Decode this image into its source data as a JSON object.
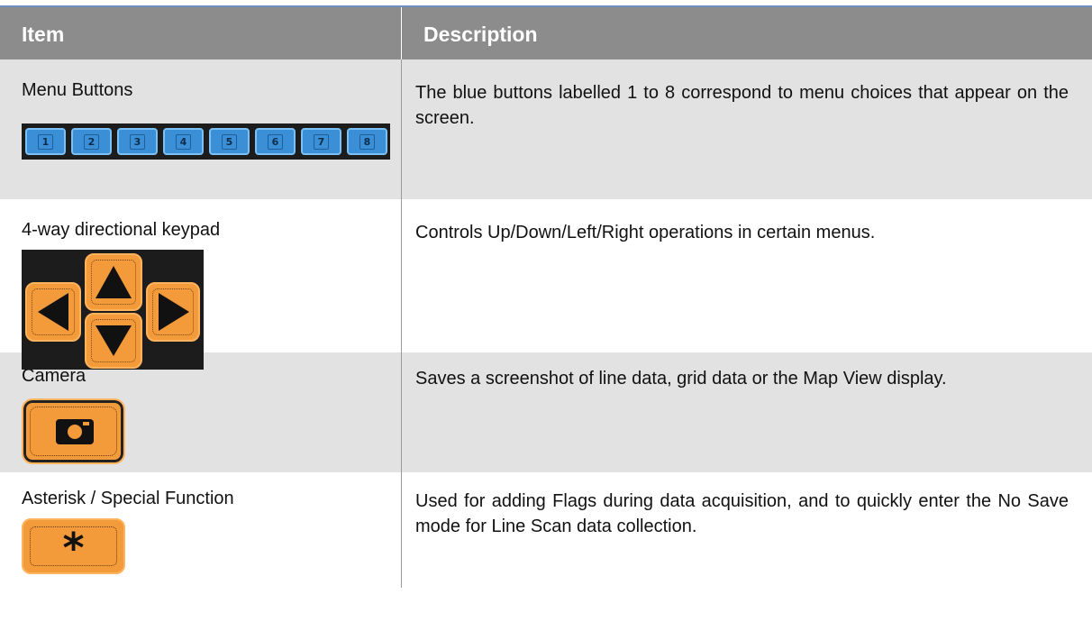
{
  "header": {
    "item": "Item",
    "description": "Description"
  },
  "rows": [
    {
      "item": "Menu Buttons",
      "description": "The blue buttons labelled 1 to 8 correspond to menu choices that appear on the screen."
    },
    {
      "item": "4-way directional keypad",
      "description": "Controls Up/Down/Left/Right operations in certain menus."
    },
    {
      "item": "Camera",
      "description": "Saves a screenshot of line data, grid data or the Map View display."
    },
    {
      "item": "Asterisk / Special Function",
      "description": "Used for adding Flags during data acquisition, and to quickly enter the No Save mode for Line Scan data collection."
    }
  ],
  "menu_buttons": [
    "1",
    "2",
    "3",
    "4",
    "5",
    "6",
    "7",
    "8"
  ],
  "asterisk_symbol": "*",
  "colors": {
    "header_bg": "#8c8c8c",
    "menu_blue": "#3a8fd6",
    "key_orange": "#f39a3b",
    "row_grey": "#e2e2e2"
  },
  "icons": [
    "left-arrow-key-icon",
    "up-arrow-key-icon",
    "down-arrow-key-icon",
    "right-arrow-key-icon",
    "camera-icon",
    "asterisk-icon"
  ]
}
